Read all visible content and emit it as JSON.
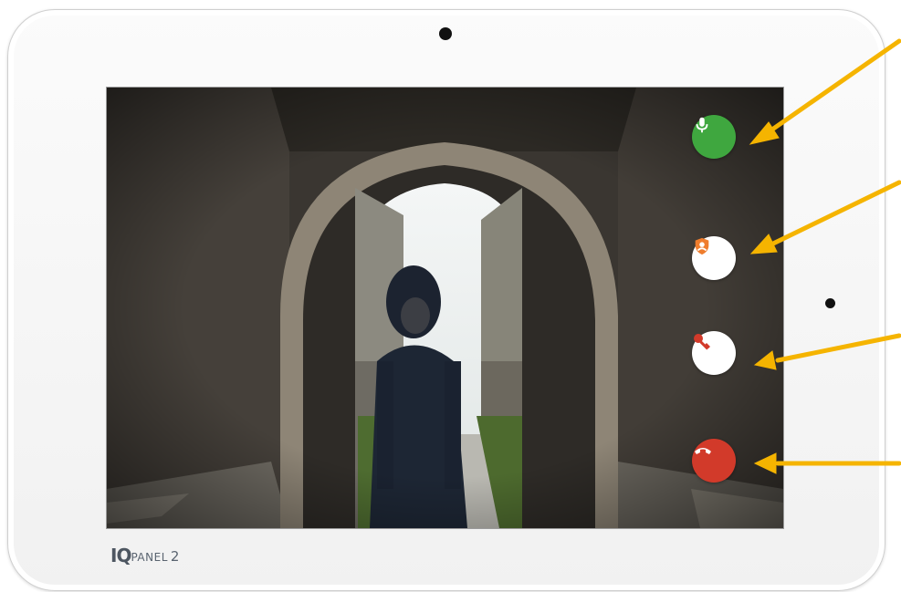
{
  "brand": {
    "mark": "IQ",
    "name": "PANEL",
    "model": "2"
  },
  "video_call": {
    "controls": [
      {
        "id": "mic",
        "icon": "microphone-icon",
        "color": "#3fa73f",
        "icon_color": "#ffffff"
      },
      {
        "id": "privacy",
        "icon": "shield-person-icon",
        "color": "#ffffff",
        "icon_color": "#ef7d2d"
      },
      {
        "id": "unlock",
        "icon": "key-icon",
        "color": "#ffffff",
        "icon_color": "#d23a2a"
      },
      {
        "id": "hangup",
        "icon": "phone-hangup-icon",
        "color": "#d23a2a",
        "icon_color": "#ffffff"
      }
    ]
  },
  "annotation": {
    "arrow_color": "#f5b400"
  }
}
